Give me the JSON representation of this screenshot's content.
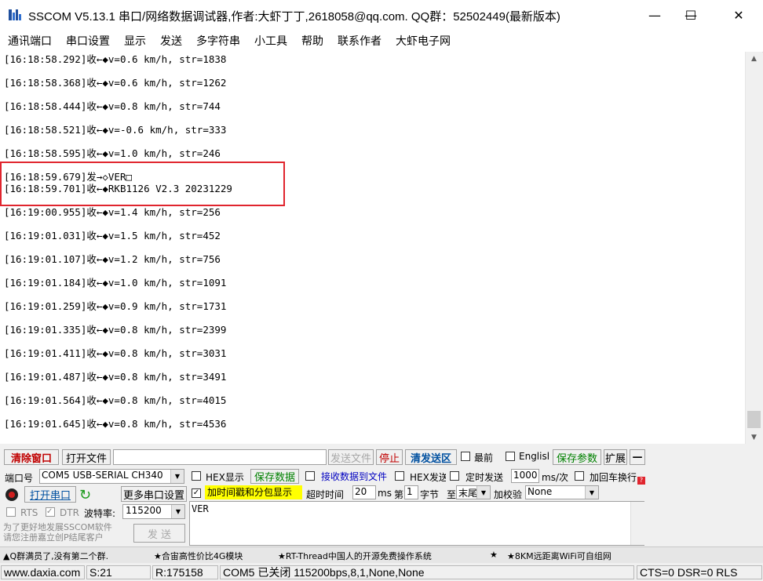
{
  "window": {
    "title": "SSCOM V5.13.1 串口/网络数据调试器,作者:大虾丁丁,2618058@qq.com. QQ群：52502449(最新版本)",
    "minimize": "—",
    "maximize": "☐",
    "close": "✕"
  },
  "menu": [
    "通讯端口",
    "串口设置",
    "显示",
    "发送",
    "多字符串",
    "小工具",
    "帮助",
    "联系作者",
    "大虾电子网"
  ],
  "log": [
    "[16:18:58.292]收←◆v=0.6 km/h, str=1838",
    "[16:18:58.368]收←◆v=0.6 km/h, str=1262",
    "[16:18:58.444]收←◆v=0.8 km/h, str=744",
    "[16:18:58.521]收←◆v=-0.6 km/h, str=333",
    "[16:18:58.595]收←◆v=1.0 km/h, str=246",
    "[16:18:59.679]发→◇VER□",
    "[16:18:59.701]收←◆RKB1126 V2.3 20231229",
    "[16:19:00.955]收←◆v=1.4 km/h, str=256",
    "[16:19:01.031]收←◆v=1.5 km/h, str=452",
    "[16:19:01.107]收←◆v=1.2 km/h, str=756",
    "[16:19:01.184]收←◆v=1.0 km/h, str=1091",
    "[16:19:01.259]收←◆v=0.9 km/h, str=1731",
    "[16:19:01.335]收←◆v=0.8 km/h, str=2399",
    "[16:19:01.411]收←◆v=0.8 km/h, str=3031",
    "[16:19:01.487]收←◆v=0.8 km/h, str=3491",
    "[16:19:01.564]收←◆v=0.8 km/h, str=4015",
    "[16:19:01.645]收←◆v=0.8 km/h, str=4536"
  ],
  "toolbar": {
    "clear_window": "清除窗口",
    "open_file": "打开文件",
    "send_file": "发送文件",
    "stop": "停止",
    "clear_send": "清发送区",
    "last": "最前",
    "english": "English",
    "save_params": "保存参数",
    "expand": "扩展",
    "collapse": "—"
  },
  "port": {
    "port_label": "端口号",
    "port_value": "COM5 USB-SERIAL CH340",
    "open_port": "打开串口",
    "more_settings": "更多串口设置",
    "rts": "RTS",
    "dtr": "DTR",
    "baud_label": "波特率:",
    "baud_value": "115200",
    "promo": "为了更好地发展SSCOM软件\n请您注册嘉立创P结尾客户"
  },
  "options": {
    "hex_display": "HEX显示",
    "save_data": "保存数据",
    "recv_to_file": "接收数据到文件",
    "hex_send": "HEX发送",
    "timed_send": "定时发送",
    "timed_value": "1000",
    "timed_unit": "ms/次",
    "add_crlf": "加回车换行",
    "timestamp": "加时间戳和分包显示",
    "timeout_label": "超时时间",
    "timeout_value": "20",
    "timeout_unit": "ms",
    "nth_label": "第",
    "nth_value": "1",
    "byte_label": "字节",
    "to_label": "至",
    "to_value": "末尾",
    "checksum_label": "加校验",
    "checksum_value": "None"
  },
  "send": {
    "text": "VER",
    "send_button": "发 送"
  },
  "ticker": {
    "item1": "▲Q群满员了,没有第二个群.",
    "item2": "★合宙高性价比4G模块",
    "item3": "★RT-Thread中国人的开源免费操作系统",
    "item4": "★",
    "item5": "★8KM远距离WiFi可自组网"
  },
  "status": {
    "site": "www.daxia.com",
    "s": "S:21",
    "r": "R:175158",
    "port_state": "COM5 已关闭  115200bps,8,1,None,None",
    "lines": "CTS=0 DSR=0 RLS"
  },
  "colors": {
    "highlight": "#e0252e",
    "timestamp_bg": "#ffff00",
    "save_green": "#008000"
  }
}
